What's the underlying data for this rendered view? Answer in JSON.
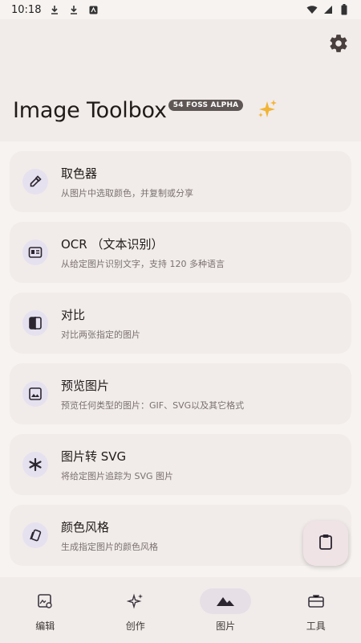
{
  "status_bar": {
    "time": "10:18",
    "left_icons": [
      "download-icon",
      "download-icon",
      "app-notification-icon"
    ],
    "right_icons": [
      "signal-icon",
      "wifi-icon",
      "battery-icon"
    ]
  },
  "header": {
    "title": "Image Toolbox",
    "badge": "54 FOSS  ALPHA",
    "settings_icon": "gear-icon",
    "sparkle_icon": "sparkles-icon"
  },
  "tools": [
    {
      "title": "取色器",
      "subtitle": "从图片中选取颜色，并复制或分享",
      "icon": "eyedropper-icon"
    },
    {
      "title": "OCR （文本识别）",
      "subtitle": "从给定图片识别文字，支持 120 多种语言",
      "icon": "ocr-icon"
    },
    {
      "title": "对比",
      "subtitle": "对比两张指定的图片",
      "icon": "compare-icon"
    },
    {
      "title": "预览图片",
      "subtitle": "预览任何类型的图片：GIF、SVG以及其它格式",
      "icon": "image-preview-icon"
    },
    {
      "title": "图片转 SVG",
      "subtitle": "将给定图片追踪为 SVG 图片",
      "icon": "asterisk-icon"
    },
    {
      "title": "颜色风格",
      "subtitle": "生成指定图片的颜色风格",
      "icon": "palette-style-icon"
    }
  ],
  "fab": {
    "icon": "clipboard-icon"
  },
  "bottom_nav": [
    {
      "label": "编辑",
      "icon": "edit-image-icon",
      "active": false
    },
    {
      "label": "创作",
      "icon": "sparkle-create-icon",
      "active": false
    },
    {
      "label": "图片",
      "icon": "mountain-icon",
      "active": true
    },
    {
      "label": "工具",
      "icon": "toolbox-icon",
      "active": false
    }
  ],
  "colors": {
    "background": "#f7f3f1",
    "surface": "#f1ecea",
    "icon_container": "#e6e1ee",
    "badge": "#5f5755",
    "active_pill": "#e6dfe6",
    "sparkle": "#e9b53c"
  }
}
